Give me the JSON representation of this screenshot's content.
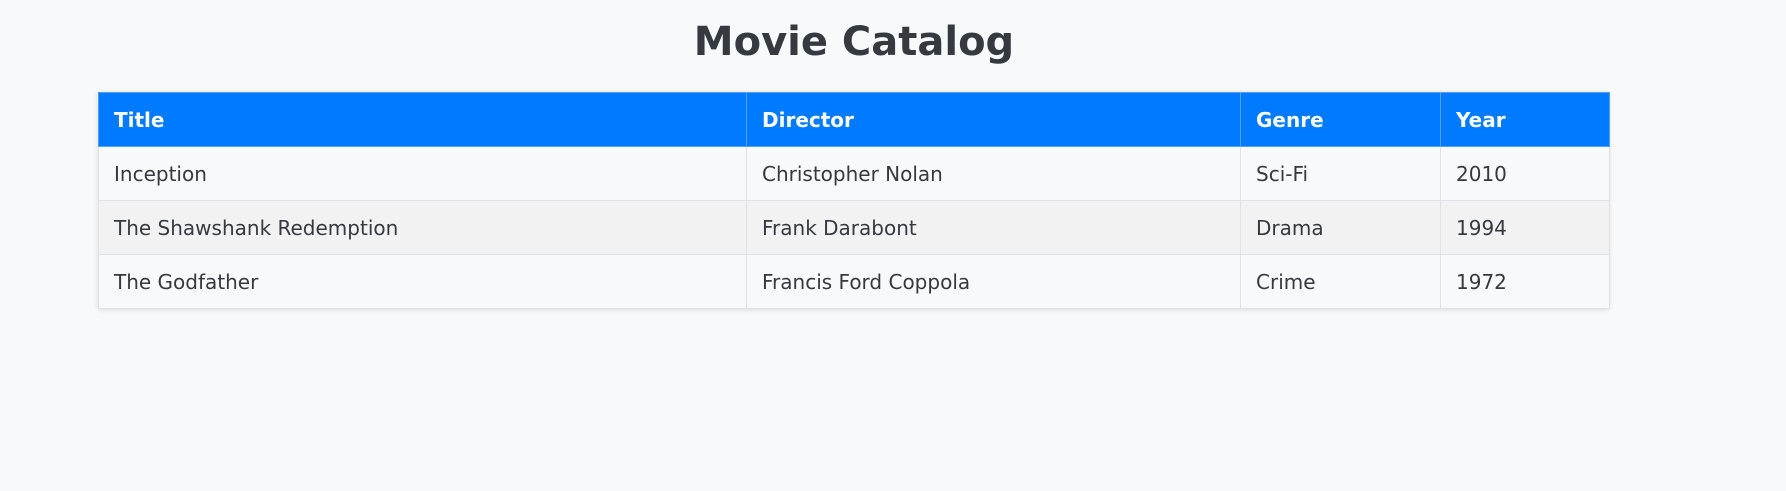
{
  "page": {
    "title": "Movie Catalog"
  },
  "colors": {
    "header_bg": "#007bff",
    "header_text": "#ffffff",
    "row_odd": "#f8f9fa",
    "row_even": "#f2f2f2",
    "text": "#343a40"
  },
  "table": {
    "headers": [
      "Title",
      "Director",
      "Genre",
      "Year"
    ],
    "rows": [
      [
        "Inception",
        "Christopher Nolan",
        "Sci-Fi",
        "2010"
      ],
      [
        "The Shawshank Redemption",
        "Frank Darabont",
        "Drama",
        "1994"
      ],
      [
        "The Godfather",
        "Francis Ford Coppola",
        "Crime",
        "1972"
      ]
    ]
  }
}
